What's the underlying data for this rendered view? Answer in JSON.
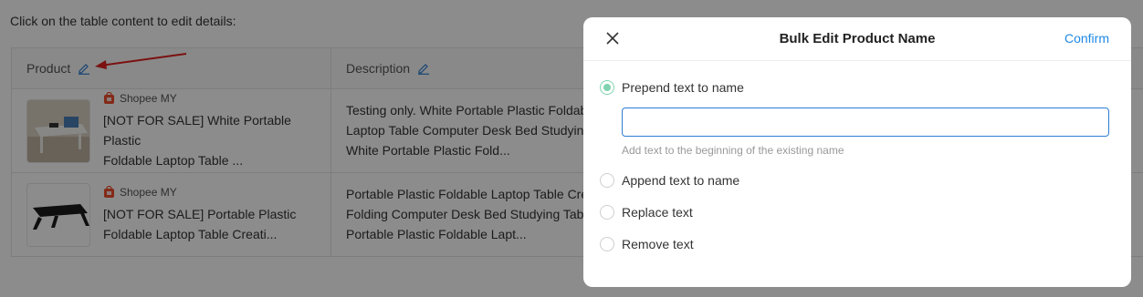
{
  "page": {
    "instructions": "Click on the table content to edit details:"
  },
  "table": {
    "headers": {
      "product": "Product",
      "description": "Description"
    },
    "rows": [
      {
        "shop": "Shopee MY",
        "name_line1": "[NOT FOR SALE] White Portable Plastic",
        "name_line2": "Foldable Laptop Table ...",
        "desc_line1": "Testing only. White Portable Plastic Foldab",
        "desc_line2": "Laptop Table Computer Desk Bed Studying",
        "desc_line3": "White Portable Plastic Fold..."
      },
      {
        "shop": "Shopee MY",
        "name_line1": "[NOT FOR SALE] Portable Plastic",
        "name_line2": "Foldable Laptop Table Creati...",
        "desc_line1": "Portable Plastic Foldable Laptop Table Cre",
        "desc_line2": "Folding Computer Desk Bed Studying Table",
        "desc_line3": "Portable Plastic Foldable Lapt..."
      }
    ]
  },
  "modal": {
    "title": "Bulk Edit Product Name",
    "confirm_label": "Confirm",
    "options": [
      {
        "label": "Prepend text to name",
        "checked": true
      },
      {
        "label": "Append text to name",
        "checked": false
      },
      {
        "label": "Replace text",
        "checked": false
      },
      {
        "label": "Remove text",
        "checked": false
      }
    ],
    "input_value": "",
    "input_hint": "Add text to the beginning of the existing name"
  },
  "colors": {
    "accent": "#1e88e5",
    "radio_checked": "#7fd3b0",
    "shop_icon": "#ee4d2d",
    "annotation_arrow": "#e02020"
  }
}
